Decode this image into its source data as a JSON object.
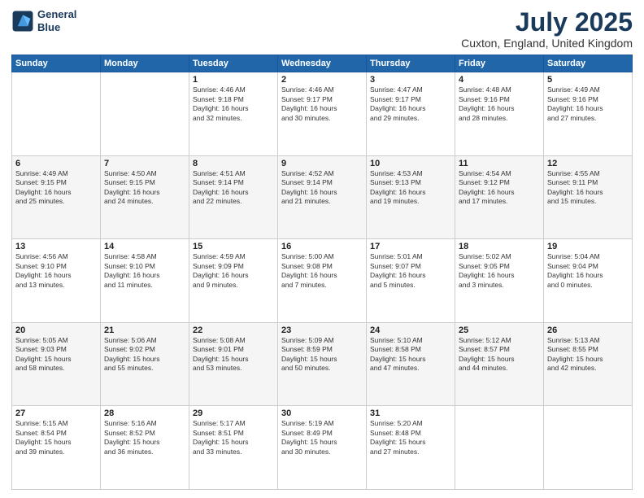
{
  "header": {
    "logo_line1": "General",
    "logo_line2": "Blue",
    "title": "July 2025",
    "subtitle": "Cuxton, England, United Kingdom"
  },
  "columns": [
    "Sunday",
    "Monday",
    "Tuesday",
    "Wednesday",
    "Thursday",
    "Friday",
    "Saturday"
  ],
  "weeks": [
    [
      {
        "day": "",
        "info": ""
      },
      {
        "day": "",
        "info": ""
      },
      {
        "day": "1",
        "info": "Sunrise: 4:46 AM\nSunset: 9:18 PM\nDaylight: 16 hours\nand 32 minutes."
      },
      {
        "day": "2",
        "info": "Sunrise: 4:46 AM\nSunset: 9:17 PM\nDaylight: 16 hours\nand 30 minutes."
      },
      {
        "day": "3",
        "info": "Sunrise: 4:47 AM\nSunset: 9:17 PM\nDaylight: 16 hours\nand 29 minutes."
      },
      {
        "day": "4",
        "info": "Sunrise: 4:48 AM\nSunset: 9:16 PM\nDaylight: 16 hours\nand 28 minutes."
      },
      {
        "day": "5",
        "info": "Sunrise: 4:49 AM\nSunset: 9:16 PM\nDaylight: 16 hours\nand 27 minutes."
      }
    ],
    [
      {
        "day": "6",
        "info": "Sunrise: 4:49 AM\nSunset: 9:15 PM\nDaylight: 16 hours\nand 25 minutes."
      },
      {
        "day": "7",
        "info": "Sunrise: 4:50 AM\nSunset: 9:15 PM\nDaylight: 16 hours\nand 24 minutes."
      },
      {
        "day": "8",
        "info": "Sunrise: 4:51 AM\nSunset: 9:14 PM\nDaylight: 16 hours\nand 22 minutes."
      },
      {
        "day": "9",
        "info": "Sunrise: 4:52 AM\nSunset: 9:14 PM\nDaylight: 16 hours\nand 21 minutes."
      },
      {
        "day": "10",
        "info": "Sunrise: 4:53 AM\nSunset: 9:13 PM\nDaylight: 16 hours\nand 19 minutes."
      },
      {
        "day": "11",
        "info": "Sunrise: 4:54 AM\nSunset: 9:12 PM\nDaylight: 16 hours\nand 17 minutes."
      },
      {
        "day": "12",
        "info": "Sunrise: 4:55 AM\nSunset: 9:11 PM\nDaylight: 16 hours\nand 15 minutes."
      }
    ],
    [
      {
        "day": "13",
        "info": "Sunrise: 4:56 AM\nSunset: 9:10 PM\nDaylight: 16 hours\nand 13 minutes."
      },
      {
        "day": "14",
        "info": "Sunrise: 4:58 AM\nSunset: 9:10 PM\nDaylight: 16 hours\nand 11 minutes."
      },
      {
        "day": "15",
        "info": "Sunrise: 4:59 AM\nSunset: 9:09 PM\nDaylight: 16 hours\nand 9 minutes."
      },
      {
        "day": "16",
        "info": "Sunrise: 5:00 AM\nSunset: 9:08 PM\nDaylight: 16 hours\nand 7 minutes."
      },
      {
        "day": "17",
        "info": "Sunrise: 5:01 AM\nSunset: 9:07 PM\nDaylight: 16 hours\nand 5 minutes."
      },
      {
        "day": "18",
        "info": "Sunrise: 5:02 AM\nSunset: 9:05 PM\nDaylight: 16 hours\nand 3 minutes."
      },
      {
        "day": "19",
        "info": "Sunrise: 5:04 AM\nSunset: 9:04 PM\nDaylight: 16 hours\nand 0 minutes."
      }
    ],
    [
      {
        "day": "20",
        "info": "Sunrise: 5:05 AM\nSunset: 9:03 PM\nDaylight: 15 hours\nand 58 minutes."
      },
      {
        "day": "21",
        "info": "Sunrise: 5:06 AM\nSunset: 9:02 PM\nDaylight: 15 hours\nand 55 minutes."
      },
      {
        "day": "22",
        "info": "Sunrise: 5:08 AM\nSunset: 9:01 PM\nDaylight: 15 hours\nand 53 minutes."
      },
      {
        "day": "23",
        "info": "Sunrise: 5:09 AM\nSunset: 8:59 PM\nDaylight: 15 hours\nand 50 minutes."
      },
      {
        "day": "24",
        "info": "Sunrise: 5:10 AM\nSunset: 8:58 PM\nDaylight: 15 hours\nand 47 minutes."
      },
      {
        "day": "25",
        "info": "Sunrise: 5:12 AM\nSunset: 8:57 PM\nDaylight: 15 hours\nand 44 minutes."
      },
      {
        "day": "26",
        "info": "Sunrise: 5:13 AM\nSunset: 8:55 PM\nDaylight: 15 hours\nand 42 minutes."
      }
    ],
    [
      {
        "day": "27",
        "info": "Sunrise: 5:15 AM\nSunset: 8:54 PM\nDaylight: 15 hours\nand 39 minutes."
      },
      {
        "day": "28",
        "info": "Sunrise: 5:16 AM\nSunset: 8:52 PM\nDaylight: 15 hours\nand 36 minutes."
      },
      {
        "day": "29",
        "info": "Sunrise: 5:17 AM\nSunset: 8:51 PM\nDaylight: 15 hours\nand 33 minutes."
      },
      {
        "day": "30",
        "info": "Sunrise: 5:19 AM\nSunset: 8:49 PM\nDaylight: 15 hours\nand 30 minutes."
      },
      {
        "day": "31",
        "info": "Sunrise: 5:20 AM\nSunset: 8:48 PM\nDaylight: 15 hours\nand 27 minutes."
      },
      {
        "day": "",
        "info": ""
      },
      {
        "day": "",
        "info": ""
      }
    ]
  ]
}
